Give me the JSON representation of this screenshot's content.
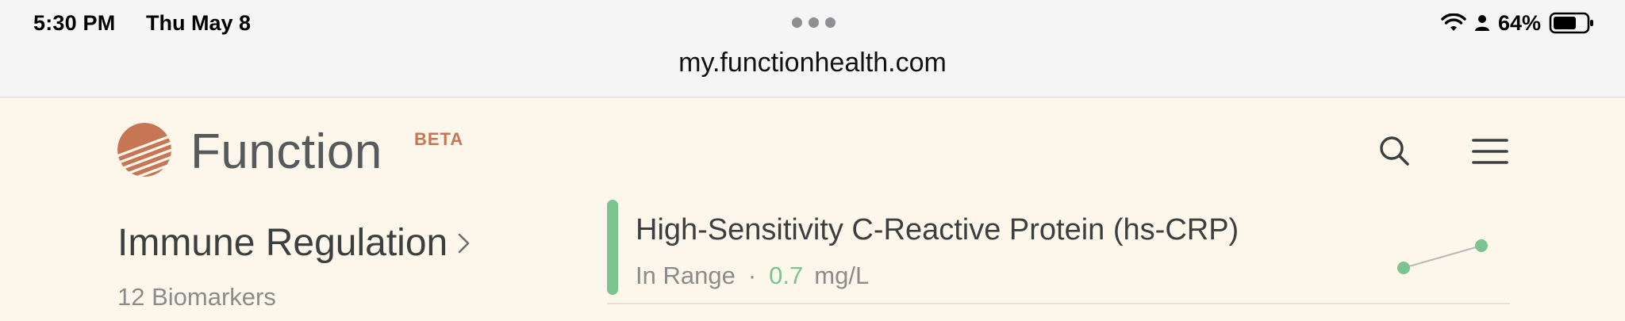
{
  "status_bar": {
    "time": "5:30 PM",
    "date": "Thu May 8",
    "battery_percent": "64%"
  },
  "browser": {
    "url": "my.functionhealth.com"
  },
  "header": {
    "brand": "Function",
    "badge": "BETA"
  },
  "category": {
    "title": "Immune Regulation",
    "count_label": "12 Biomarkers"
  },
  "biomarker": {
    "name": "High-Sensitivity C-Reactive Protein (hs-CRP)",
    "status": "In Range",
    "separator": "·",
    "value": "0.7",
    "unit": "mg/L",
    "status_color": "#7bc48f"
  },
  "icons": {
    "search": "search-icon",
    "menu": "hamburger-menu-icon",
    "logo": "function-logo-icon",
    "wifi": "wifi-icon",
    "person": "person-icon",
    "battery": "battery-icon",
    "chevron": "chevron-right-icon"
  },
  "colors": {
    "brand_accent": "#c67655",
    "page_background": "#fcf7ea",
    "in_range": "#7bc48f"
  }
}
